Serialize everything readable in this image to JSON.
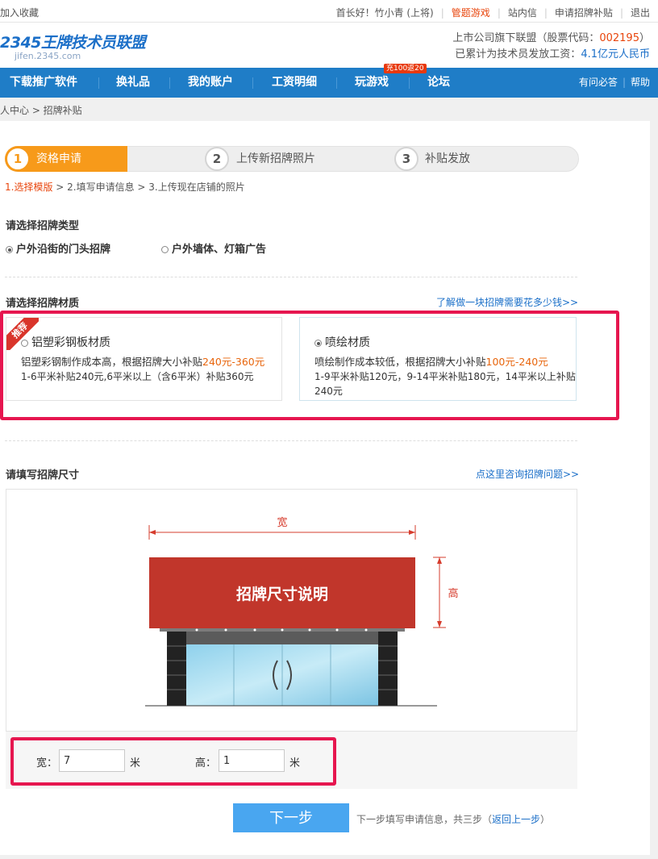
{
  "topbar": {
    "favorite": "加入收藏",
    "greeting": "首长好！竹小青 (上将)",
    "game_link": "管题游戏",
    "inbox": "站内信",
    "apply": "申请招牌补贴",
    "logout": "退出"
  },
  "header": {
    "logo_main": "2345王牌技术员联盟",
    "logo_sub": "jifen.2345.com",
    "company_prefix": "上市公司旗下联盟（股票代码：",
    "stock_code": "002195",
    "company_suffix": "）",
    "paid_prefix": "已累计为技术员发放工资：",
    "paid_amount": "4.1亿元人民币"
  },
  "nav": {
    "items": [
      "下载推广软件",
      "换礼品",
      "我的账户",
      "工资明细",
      "玩游戏",
      "论坛"
    ],
    "promo_badge": "充100返20",
    "faq": "有问必答",
    "help": "帮助"
  },
  "breadcrumb": "人中心 > 招牌补贴",
  "steps": {
    "items": [
      {
        "num": "1",
        "label": "资格申请"
      },
      {
        "num": "2",
        "label": "上传新招牌照片"
      },
      {
        "num": "3",
        "label": "补贴发放"
      }
    ],
    "subpath_current": "1.选择模版",
    "subpath_rest": " > 2.填写申请信息 > 3.上传现在店铺的照片"
  },
  "type_section": {
    "title": "请选择招牌类型",
    "options": [
      "户外沿街的门头招牌",
      "户外墙体、灯箱广告"
    ]
  },
  "material_section": {
    "title": "请选择招牌材质",
    "link": "了解做一块招牌需要花多少钱>>",
    "left": {
      "badge": "推荐",
      "title": "铝塑彩钢板材质",
      "desc_prefix": "铝塑彩钢制作成本高，根据招牌大小补贴",
      "desc_range": "240元-360元",
      "detail": "1-6平米补贴240元,6平米以上（含6平米）补贴360元"
    },
    "right": {
      "title": "喷绘材质",
      "desc_prefix": "喷绘制作成本较低，根据招牌大小补贴",
      "desc_range": "100元-240元",
      "detail_line1": "1-9平米补贴120元，9-14平米补贴180元，14平米以上补贴",
      "detail_line2": "240元"
    }
  },
  "size_section": {
    "title": "请填写招牌尺寸",
    "link": "点这里咨询招牌问题>>",
    "illustration": {
      "width_label": "宽",
      "height_label": "高",
      "sign_text": "招牌尺寸说明"
    },
    "width_label": "宽：",
    "width_value": "7",
    "width_unit": "米",
    "height_label": "高：",
    "height_value": "1",
    "height_unit": "米"
  },
  "footer_action": {
    "next_button": "下一步",
    "note_prefix": "下一步填写申请信息，共三步（",
    "back_link": "返回上一步",
    "note_suffix": "）"
  },
  "colors": {
    "nav_bg": "#1f7dc7",
    "step_active": "#f79a1a",
    "accent_orange": "#e8650c",
    "highlight_box": "#e6164f",
    "button_blue": "#49a6f0"
  }
}
